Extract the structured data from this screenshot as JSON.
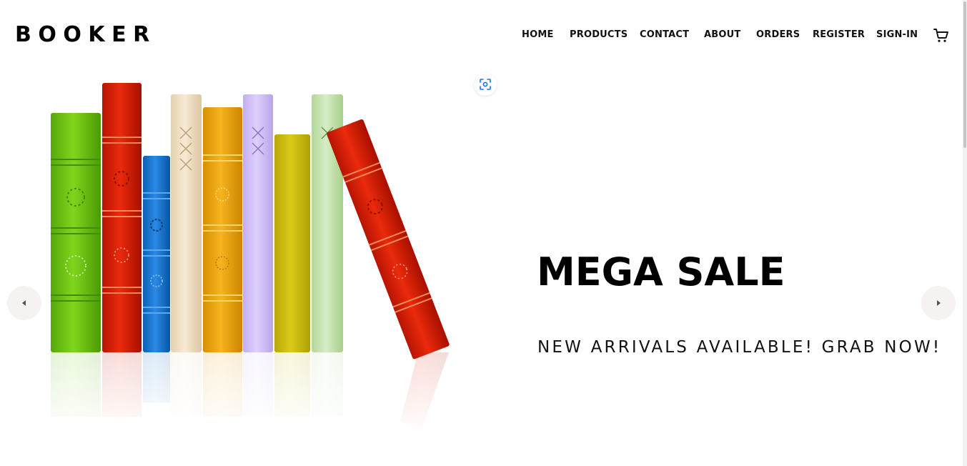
{
  "brand": {
    "name": "BOOKER"
  },
  "nav": {
    "items": [
      {
        "label": "HOME"
      },
      {
        "label": "PRODUCTS"
      },
      {
        "label": "CONTACT"
      },
      {
        "label": "ABOUT"
      },
      {
        "label": "ORDERS"
      },
      {
        "label": "REGISTER"
      },
      {
        "label": "SIGN-IN"
      }
    ],
    "cart_icon": "shopping-cart-icon"
  },
  "hero": {
    "title": "MEGA SALE",
    "subtitle": "NEW ARRIVALS AVAILABLE! GRAB NOW!",
    "image_icon": "image-scan-icon",
    "prev_icon": "arrow-left-icon",
    "next_icon": "arrow-right-icon",
    "book_colors": [
      "#6cc310",
      "#d81d06",
      "#1677d2",
      "#f2e2c8",
      "#efa80a",
      "#d6c6f7",
      "#cfbf10",
      "#c8e4b4",
      "#d81d06"
    ]
  }
}
